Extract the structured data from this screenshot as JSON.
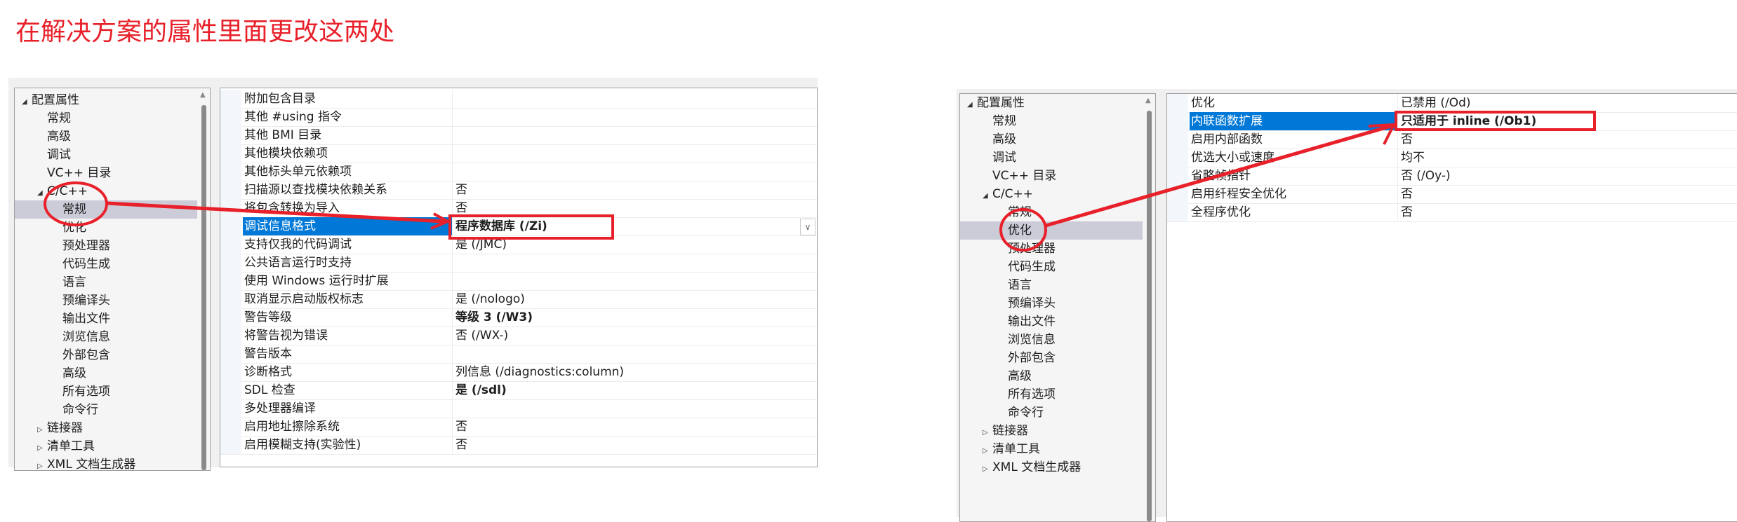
{
  "annotation_title": "在解决方案的属性里面更改这两处",
  "left_panel": {
    "tree": [
      {
        "label": "配置属性",
        "level": 0,
        "toggle": "◢"
      },
      {
        "label": "常规",
        "level": 1
      },
      {
        "label": "高级",
        "level": 1
      },
      {
        "label": "调试",
        "level": 1
      },
      {
        "label": "VC++ 目录",
        "level": 1
      },
      {
        "label": "C/C++",
        "level": 1,
        "toggle": "◢"
      },
      {
        "label": "常规",
        "level": 2,
        "selected": true
      },
      {
        "label": "优化",
        "level": 2
      },
      {
        "label": "预处理器",
        "level": 2
      },
      {
        "label": "代码生成",
        "level": 2
      },
      {
        "label": "语言",
        "level": 2
      },
      {
        "label": "预编译头",
        "level": 2
      },
      {
        "label": "输出文件",
        "level": 2
      },
      {
        "label": "浏览信息",
        "level": 2
      },
      {
        "label": "外部包含",
        "level": 2
      },
      {
        "label": "高级",
        "level": 2
      },
      {
        "label": "所有选项",
        "level": 2
      },
      {
        "label": "命令行",
        "level": 2
      },
      {
        "label": "链接器",
        "level": 1,
        "toggle": "▷"
      },
      {
        "label": "清单工具",
        "level": 1,
        "toggle": "▷"
      },
      {
        "label": "XML 文档生成器",
        "level": 1,
        "toggle": "▷"
      }
    ],
    "properties": [
      {
        "name": "附加包含目录",
        "value": ""
      },
      {
        "name": "其他 #using 指令",
        "value": ""
      },
      {
        "name": "其他 BMI 目录",
        "value": ""
      },
      {
        "name": "其他模块依赖项",
        "value": ""
      },
      {
        "name": "其他标头单元依赖项",
        "value": ""
      },
      {
        "name": "扫描源以查找模块依赖关系",
        "value": "否"
      },
      {
        "name": "将包含转换为导入",
        "value": "否"
      },
      {
        "name": "调试信息格式",
        "value": "程序数据库 (/Zi)",
        "bold": true,
        "selected": true
      },
      {
        "name": "支持仅我的代码调试",
        "value": "是 (/JMC)"
      },
      {
        "name": "公共语言运行时支持",
        "value": ""
      },
      {
        "name": "使用 Windows 运行时扩展",
        "value": ""
      },
      {
        "name": "取消显示启动版权标志",
        "value": "是 (/nologo)"
      },
      {
        "name": "警告等级",
        "value": "等级 3 (/W3)",
        "bold": true
      },
      {
        "name": "将警告视为错误",
        "value": "否 (/WX-)"
      },
      {
        "name": "警告版本",
        "value": ""
      },
      {
        "name": "诊断格式",
        "value": "列信息 (/diagnostics:column)"
      },
      {
        "name": "SDL 检查",
        "value": "是 (/sdl)",
        "bold": true
      },
      {
        "name": "多处理器编译",
        "value": ""
      },
      {
        "name": "启用地址擦除系统",
        "value": "否"
      },
      {
        "name": "启用模糊支持(实验性)",
        "value": "否"
      }
    ],
    "dropdown_glyph": "∨"
  },
  "right_panel": {
    "tree": [
      {
        "label": "配置属性",
        "level": 0,
        "toggle": "◢"
      },
      {
        "label": "常规",
        "level": 1
      },
      {
        "label": "高级",
        "level": 1
      },
      {
        "label": "调试",
        "level": 1
      },
      {
        "label": "VC++ 目录",
        "level": 1
      },
      {
        "label": "C/C++",
        "level": 1,
        "toggle": "◢"
      },
      {
        "label": "常规",
        "level": 2
      },
      {
        "label": "优化",
        "level": 2,
        "selected": true
      },
      {
        "label": "预处理器",
        "level": 2
      },
      {
        "label": "代码生成",
        "level": 2
      },
      {
        "label": "语言",
        "level": 2
      },
      {
        "label": "预编译头",
        "level": 2
      },
      {
        "label": "输出文件",
        "level": 2
      },
      {
        "label": "浏览信息",
        "level": 2
      },
      {
        "label": "外部包含",
        "level": 2
      },
      {
        "label": "高级",
        "level": 2
      },
      {
        "label": "所有选项",
        "level": 2
      },
      {
        "label": "命令行",
        "level": 2
      },
      {
        "label": "链接器",
        "level": 1,
        "toggle": "▷"
      },
      {
        "label": "清单工具",
        "level": 1,
        "toggle": "▷"
      },
      {
        "label": "XML 文档生成器",
        "level": 1,
        "toggle": "▷"
      }
    ],
    "properties": [
      {
        "name": "优化",
        "value": "已禁用 (/Od)"
      },
      {
        "name": "内联函数扩展",
        "value": "只适用于   inline (/Ob1)",
        "bold": true,
        "selected": true
      },
      {
        "name": "启用内部函数",
        "value": "否"
      },
      {
        "name": "优选大小或速度",
        "value": "均不"
      },
      {
        "name": "省略帧指针",
        "value": "否 (/Oy-)"
      },
      {
        "name": "启用纤程安全优化",
        "value": "否"
      },
      {
        "name": "全程序优化",
        "value": "否"
      }
    ]
  },
  "colors": {
    "annotation": "#e8202a",
    "selection": "#0078d7",
    "tree_selection": "#ccccd9"
  }
}
